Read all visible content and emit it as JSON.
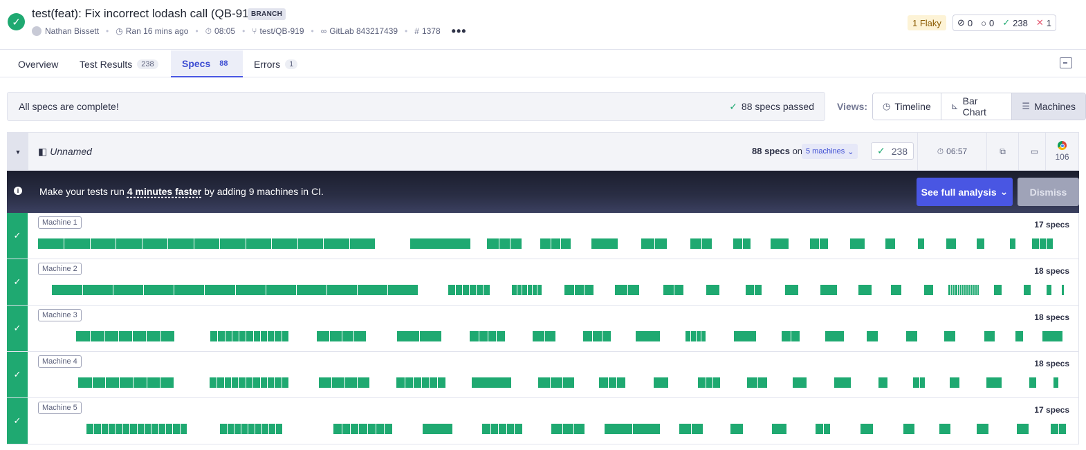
{
  "run": {
    "title": "test(feat): Fix incorrect lodash call (QB-919)",
    "badge": "BRANCH",
    "author": "Nathan Bissett",
    "ran": "Ran 16 mins ago",
    "duration": "08:05",
    "branch": "test/QB-919",
    "ci": "GitLab 843217439",
    "run_number": "1378"
  },
  "status_counts": {
    "flaky": "1 Flaky",
    "skipped": "0",
    "pending": "0",
    "passed": "238",
    "failed": "1"
  },
  "tabs": [
    {
      "label": "Overview",
      "count": ""
    },
    {
      "label": "Test Results",
      "count": "238"
    },
    {
      "label": "Specs",
      "count": "88"
    },
    {
      "label": "Errors",
      "count": "1"
    }
  ],
  "banner": {
    "message": "All specs are complete!",
    "passed": "88 specs passed"
  },
  "views": {
    "label": "Views:",
    "options": [
      "Timeline",
      "Bar Chart",
      "Machines"
    ],
    "active": "Machines"
  },
  "group": {
    "name": "Unnamed",
    "specs": "88 specs",
    "on": "on",
    "machines": "5 machines",
    "passed": "238",
    "duration": "06:57",
    "browser_count": "106"
  },
  "promo": {
    "text_before": "Make your tests run ",
    "highlight": "4 minutes faster",
    "text_after": " by adding 9 machines in CI.",
    "analysis_button": "See full analysis",
    "dismiss_button": "Dismiss"
  },
  "machines": [
    {
      "name": "Machine 1",
      "specs": "17 specs"
    },
    {
      "name": "Machine 2",
      "specs": "18 specs"
    },
    {
      "name": "Machine 3",
      "specs": "18 specs"
    },
    {
      "name": "Machine 4",
      "specs": "18 specs"
    },
    {
      "name": "Machine 5",
      "specs": "17 specs"
    }
  ],
  "colors": {
    "pass": "#1fa971",
    "accent": "#4956e3",
    "promo_bg": "#1b1e2e"
  }
}
